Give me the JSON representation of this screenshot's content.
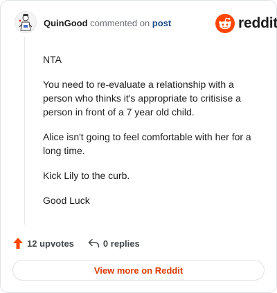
{
  "header": {
    "username": "QuinGood",
    "action_text": "commented on",
    "link_text": "post",
    "brand": "reddit",
    "brand_color": "#ff4500"
  },
  "comment": {
    "paragraphs": [
      "NTA",
      "You need to re-evaluate a relationship with a person who thinks it's appropriate to critisise a person in front of a 7 year old child.",
      "Alice isn't going to feel comfortable with her for a long time.",
      "Kick Lily to the curb.",
      "Good Luck"
    ]
  },
  "footer": {
    "upvotes": "12 upvotes",
    "replies": "0 replies",
    "view_more": "View more on Reddit",
    "upvote_color": "#ff4500",
    "view_more_color": "#d93a00"
  },
  "icons": {
    "upvote": "upvote-arrow-icon",
    "reply": "reply-arrow-icon",
    "logo": "reddit-snoo-icon",
    "avatar": "user-avatar"
  }
}
